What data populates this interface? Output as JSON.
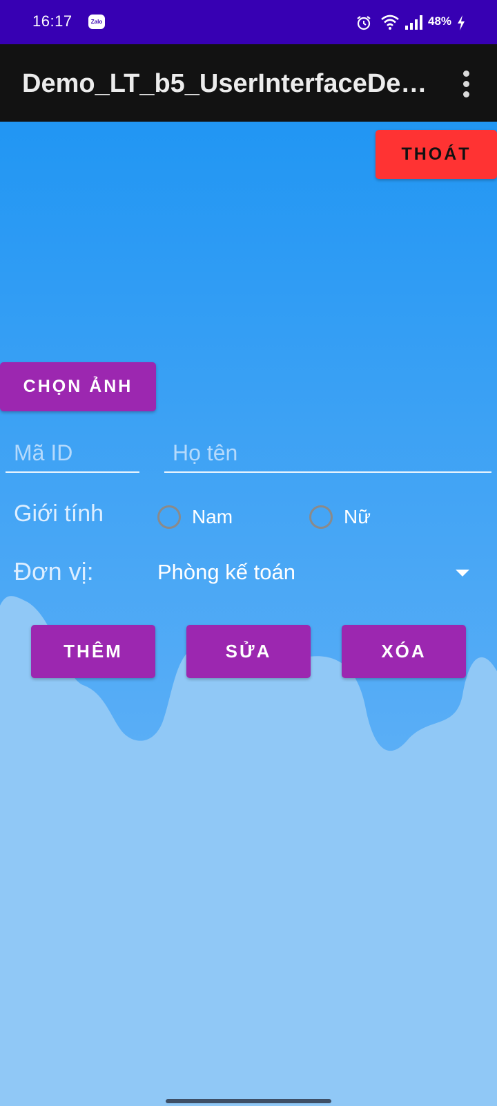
{
  "status_bar": {
    "time": "16:17",
    "app_icon": "Zalo",
    "battery": "48%",
    "icons": [
      "zalo-icon",
      "alarm-icon",
      "wifi-icon",
      "signal-icon",
      "charging-icon"
    ]
  },
  "app_bar": {
    "title": "Demo_LT_b5_UserInterfaceDe…",
    "overflow_icon": "more-vert-icon"
  },
  "buttons": {
    "exit": "THOÁT",
    "choose_image": "CHỌN ẢNH",
    "add": "THÊM",
    "edit": "SỬA",
    "delete": "XÓA"
  },
  "form": {
    "id_placeholder": "Mã ID",
    "id_value": "",
    "name_placeholder": "Họ tên",
    "name_value": "",
    "gender_label": "Giới tính",
    "gender_options": [
      "Nam",
      "Nữ"
    ],
    "department_label": "Đơn vị:",
    "department_selected": "Phòng kế toán"
  },
  "colors": {
    "status_bar": "#3700b3",
    "app_bar": "#121212",
    "accent_purple": "#9c27b0",
    "exit_red": "#ff3333",
    "background_top": "#2196f3",
    "background_light": "#90c8f6"
  }
}
